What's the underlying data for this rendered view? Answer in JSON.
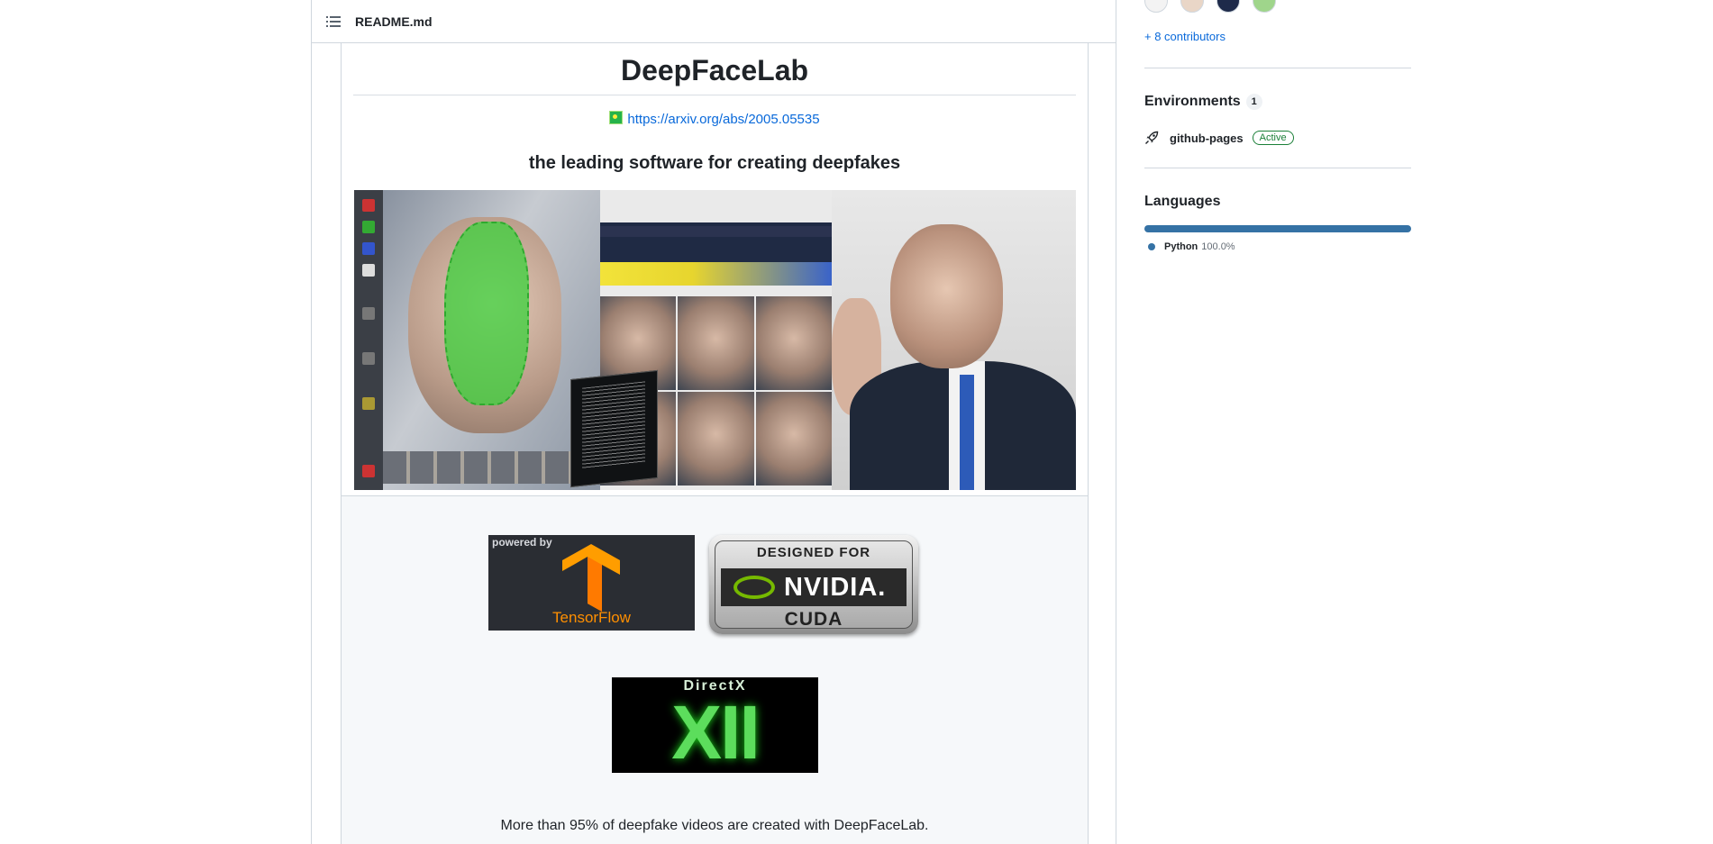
{
  "readme": {
    "filename": "README.md",
    "title": "DeepFaceLab",
    "arxiv_link": "https://arxiv.org/abs/2005.05535",
    "subtitle": "the leading software for creating deepfakes",
    "badges": {
      "tensorflow_powered": "powered by",
      "tensorflow_name": "TensorFlow",
      "nvidia_top": "DESIGNED FOR",
      "nvidia_name": "NVIDIA.",
      "nvidia_bottom": "CUDA",
      "directx_top": "DirectX",
      "directx_version": "XII"
    },
    "footer_text": "More than 95% of deepfake videos are created with DeepFaceLab."
  },
  "sidebar": {
    "contributors_link": "+ 8 contributors",
    "environments": {
      "title": "Environments",
      "count": "1",
      "items": [
        {
          "name": "github-pages",
          "status": "Active"
        }
      ]
    },
    "languages": {
      "title": "Languages",
      "items": [
        {
          "name": "Python",
          "percent": "100.0%",
          "color": "#3572A5"
        }
      ]
    }
  },
  "colors": {
    "link": "#0969da",
    "border": "#d0d7de",
    "active_green": "#1a7f37",
    "python_blue": "#3572A5"
  },
  "icons": [
    "list-icon",
    "rocket-icon",
    "image-icon"
  ]
}
